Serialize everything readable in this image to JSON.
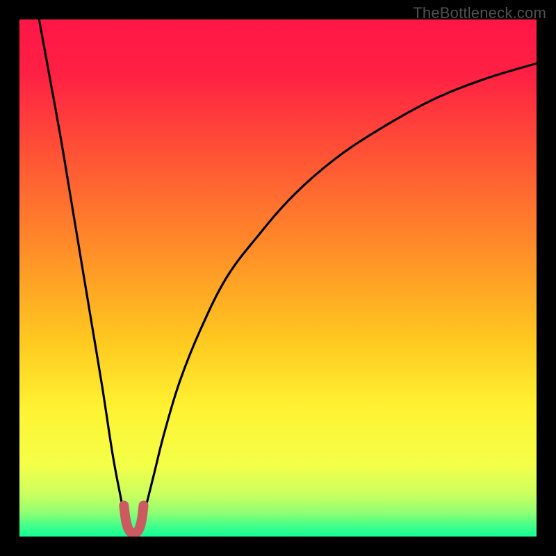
{
  "watermark": "TheBottleneck.com",
  "colors": {
    "frame": "#000000",
    "curve_main": "#000000",
    "curve_tip": "#cb5a61",
    "gradient_stops": [
      {
        "pos": 0.0,
        "color": "#ff1746"
      },
      {
        "pos": 0.1,
        "color": "#ff1f44"
      },
      {
        "pos": 0.25,
        "color": "#ff4f36"
      },
      {
        "pos": 0.45,
        "color": "#ff8f28"
      },
      {
        "pos": 0.62,
        "color": "#ffc820"
      },
      {
        "pos": 0.75,
        "color": "#fff232"
      },
      {
        "pos": 0.86,
        "color": "#f4ff48"
      },
      {
        "pos": 0.92,
        "color": "#c9ff60"
      },
      {
        "pos": 0.955,
        "color": "#8dff73"
      },
      {
        "pos": 0.975,
        "color": "#4dff86"
      },
      {
        "pos": 1.0,
        "color": "#12ff95"
      }
    ]
  },
  "chart_data": {
    "type": "line",
    "title": "",
    "xlabel": "",
    "ylabel": "",
    "xlim": [
      0,
      100
    ],
    "ylim": [
      0,
      100
    ],
    "series": [
      {
        "name": "left-branch",
        "x": [
          3.8,
          6,
          8,
          10,
          12,
          14,
          16,
          18,
          19.5,
          20.5,
          21.2
        ],
        "values": [
          100,
          88,
          77,
          65,
          53,
          41,
          29,
          16,
          8,
          3,
          0.5
        ]
      },
      {
        "name": "right-branch",
        "x": [
          23.0,
          24,
          26,
          28,
          31,
          35,
          40,
          46,
          53,
          61,
          70,
          80,
          90,
          100
        ],
        "values": [
          0.5,
          4,
          12,
          20,
          30,
          40,
          50,
          58,
          66,
          73,
          79,
          84.5,
          88.5,
          91.5
        ]
      },
      {
        "name": "tip-u",
        "x": [
          20.2,
          20.6,
          21.2,
          22.1,
          23.0,
          23.6,
          24.0
        ],
        "values": [
          6.0,
          3.0,
          1.2,
          0.6,
          1.2,
          3.0,
          6.0
        ]
      }
    ]
  }
}
